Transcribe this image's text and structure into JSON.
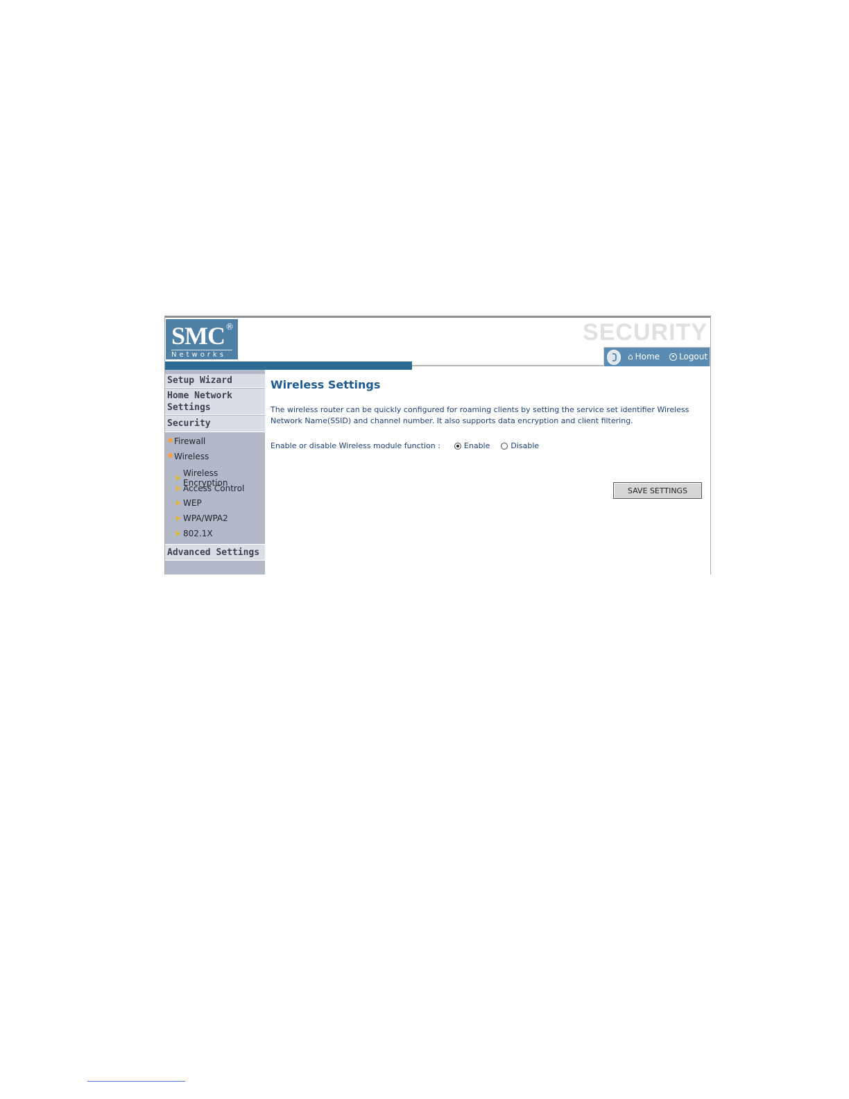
{
  "header": {
    "logo_main": "SMC",
    "logo_reg": "®",
    "logo_sub": "Networks",
    "section_title": "SECURITY",
    "home_label": "Home",
    "logout_label": "Logout"
  },
  "sidebar": {
    "setup_wizard": "Setup Wizard",
    "home_network": "Home Network Settings",
    "security": "Security",
    "firewall": "Firewall",
    "wireless": "Wireless",
    "wireless_encryption": "Wireless Encryption",
    "access_control": "Access Control",
    "wep": "WEP",
    "wpa": "WPA/WPA2",
    "dot1x": "802.1X",
    "advanced_settings": "Advanced Settings"
  },
  "main": {
    "title": "Wireless Settings",
    "description": "The wireless router can be quickly configured for roaming clients by setting the service set identifier Wireless Network Name(SSID) and channel number. It also supports data encryption and client filtering.",
    "toggle_label": "Enable or disable Wireless module function :",
    "enable_label": "Enable",
    "disable_label": "Disable",
    "selected": "Enable",
    "save_label": "SAVE SETTINGS"
  },
  "colors": {
    "brand_blue": "#2b6c94",
    "sidebar_bg": "#b3b8c9",
    "title_blue": "#1b5a93"
  }
}
